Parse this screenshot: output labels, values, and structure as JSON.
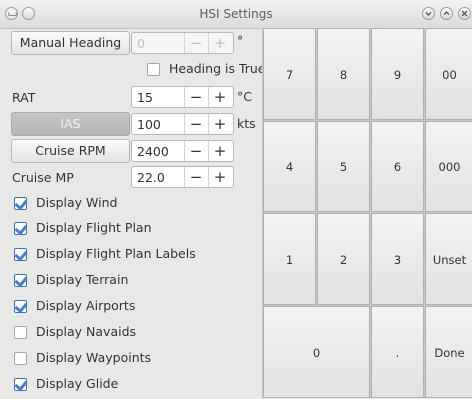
{
  "window": {
    "title": "HSI Settings"
  },
  "heading": {
    "button_label": "Manual Heading",
    "value": "0",
    "unit": "°",
    "true_label": "Heading is True",
    "true_checked": false
  },
  "rat": {
    "label": "RAT",
    "value": "15",
    "unit": "°C"
  },
  "ias": {
    "button_label": "IAS",
    "value": "100",
    "unit": "kts"
  },
  "cruise_rpm": {
    "button_label": "Cruise RPM",
    "value": "2400"
  },
  "cruise_mp": {
    "label": "Cruise MP",
    "value": "22.0"
  },
  "stepper": {
    "minus": "−",
    "plus": "+"
  },
  "checkboxes": [
    {
      "label": "Display Wind",
      "checked": true
    },
    {
      "label": "Display Flight Plan",
      "checked": true
    },
    {
      "label": "Display Flight Plan Labels",
      "checked": true
    },
    {
      "label": "Display Terrain",
      "checked": true
    },
    {
      "label": "Display Airports",
      "checked": true
    },
    {
      "label": "Display Navaids",
      "checked": false
    },
    {
      "label": "Display Waypoints",
      "checked": false
    },
    {
      "label": "Display Glide",
      "checked": true
    }
  ],
  "keypad": {
    "k7": "7",
    "k8": "8",
    "k9": "9",
    "k00": "00",
    "k4": "4",
    "k5": "5",
    "k6": "6",
    "k000": "000",
    "k1": "1",
    "k2": "2",
    "k3": "3",
    "unset": "Unset",
    "k0": "0",
    "dot": ".",
    "done": "Done"
  }
}
